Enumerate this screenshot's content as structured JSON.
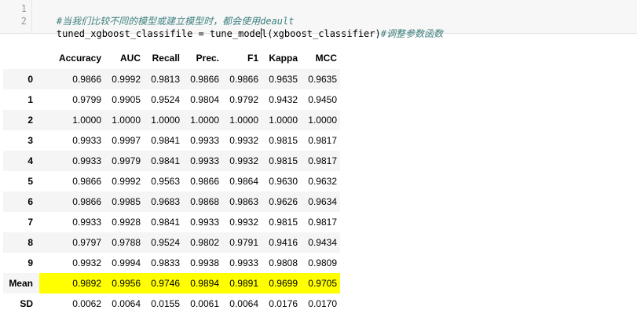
{
  "code": {
    "line_numbers": [
      "1",
      "2"
    ],
    "line1_comment": "#当我们比较不同的模型或建立模型时，都会使用deault",
    "line2_before_cursor": "tuned_xgboost_classifile = tune_mode",
    "line2_after_cursor": "l(xgboost_classifier)",
    "line2_comment": "#调整参数函数"
  },
  "table": {
    "columns": [
      "Accuracy",
      "AUC",
      "Recall",
      "Prec.",
      "F1",
      "Kappa",
      "MCC"
    ],
    "rows": [
      {
        "index": "0",
        "values": [
          "0.9866",
          "0.9992",
          "0.9813",
          "0.9866",
          "0.9866",
          "0.9635",
          "0.9635"
        ]
      },
      {
        "index": "1",
        "values": [
          "0.9799",
          "0.9905",
          "0.9524",
          "0.9804",
          "0.9792",
          "0.9432",
          "0.9450"
        ]
      },
      {
        "index": "2",
        "values": [
          "1.0000",
          "1.0000",
          "1.0000",
          "1.0000",
          "1.0000",
          "1.0000",
          "1.0000"
        ]
      },
      {
        "index": "3",
        "values": [
          "0.9933",
          "0.9997",
          "0.9841",
          "0.9933",
          "0.9932",
          "0.9815",
          "0.9817"
        ]
      },
      {
        "index": "4",
        "values": [
          "0.9933",
          "0.9979",
          "0.9841",
          "0.9933",
          "0.9932",
          "0.9815",
          "0.9817"
        ]
      },
      {
        "index": "5",
        "values": [
          "0.9866",
          "0.9992",
          "0.9563",
          "0.9866",
          "0.9864",
          "0.9630",
          "0.9632"
        ]
      },
      {
        "index": "6",
        "values": [
          "0.9866",
          "0.9985",
          "0.9683",
          "0.9868",
          "0.9863",
          "0.9626",
          "0.9634"
        ]
      },
      {
        "index": "7",
        "values": [
          "0.9933",
          "0.9928",
          "0.9841",
          "0.9933",
          "0.9932",
          "0.9815",
          "0.9817"
        ]
      },
      {
        "index": "8",
        "values": [
          "0.9797",
          "0.9788",
          "0.9524",
          "0.9802",
          "0.9791",
          "0.9416",
          "0.9434"
        ]
      },
      {
        "index": "9",
        "values": [
          "0.9932",
          "0.9994",
          "0.9833",
          "0.9938",
          "0.9933",
          "0.9808",
          "0.9809"
        ]
      },
      {
        "index": "Mean",
        "values": [
          "0.9892",
          "0.9956",
          "0.9746",
          "0.9894",
          "0.9891",
          "0.9699",
          "0.9705"
        ],
        "highlight": true
      },
      {
        "index": "SD",
        "values": [
          "0.0062",
          "0.0064",
          "0.0155",
          "0.0061",
          "0.0064",
          "0.0176",
          "0.0170"
        ]
      }
    ],
    "highlight_color": "#ffff00"
  }
}
